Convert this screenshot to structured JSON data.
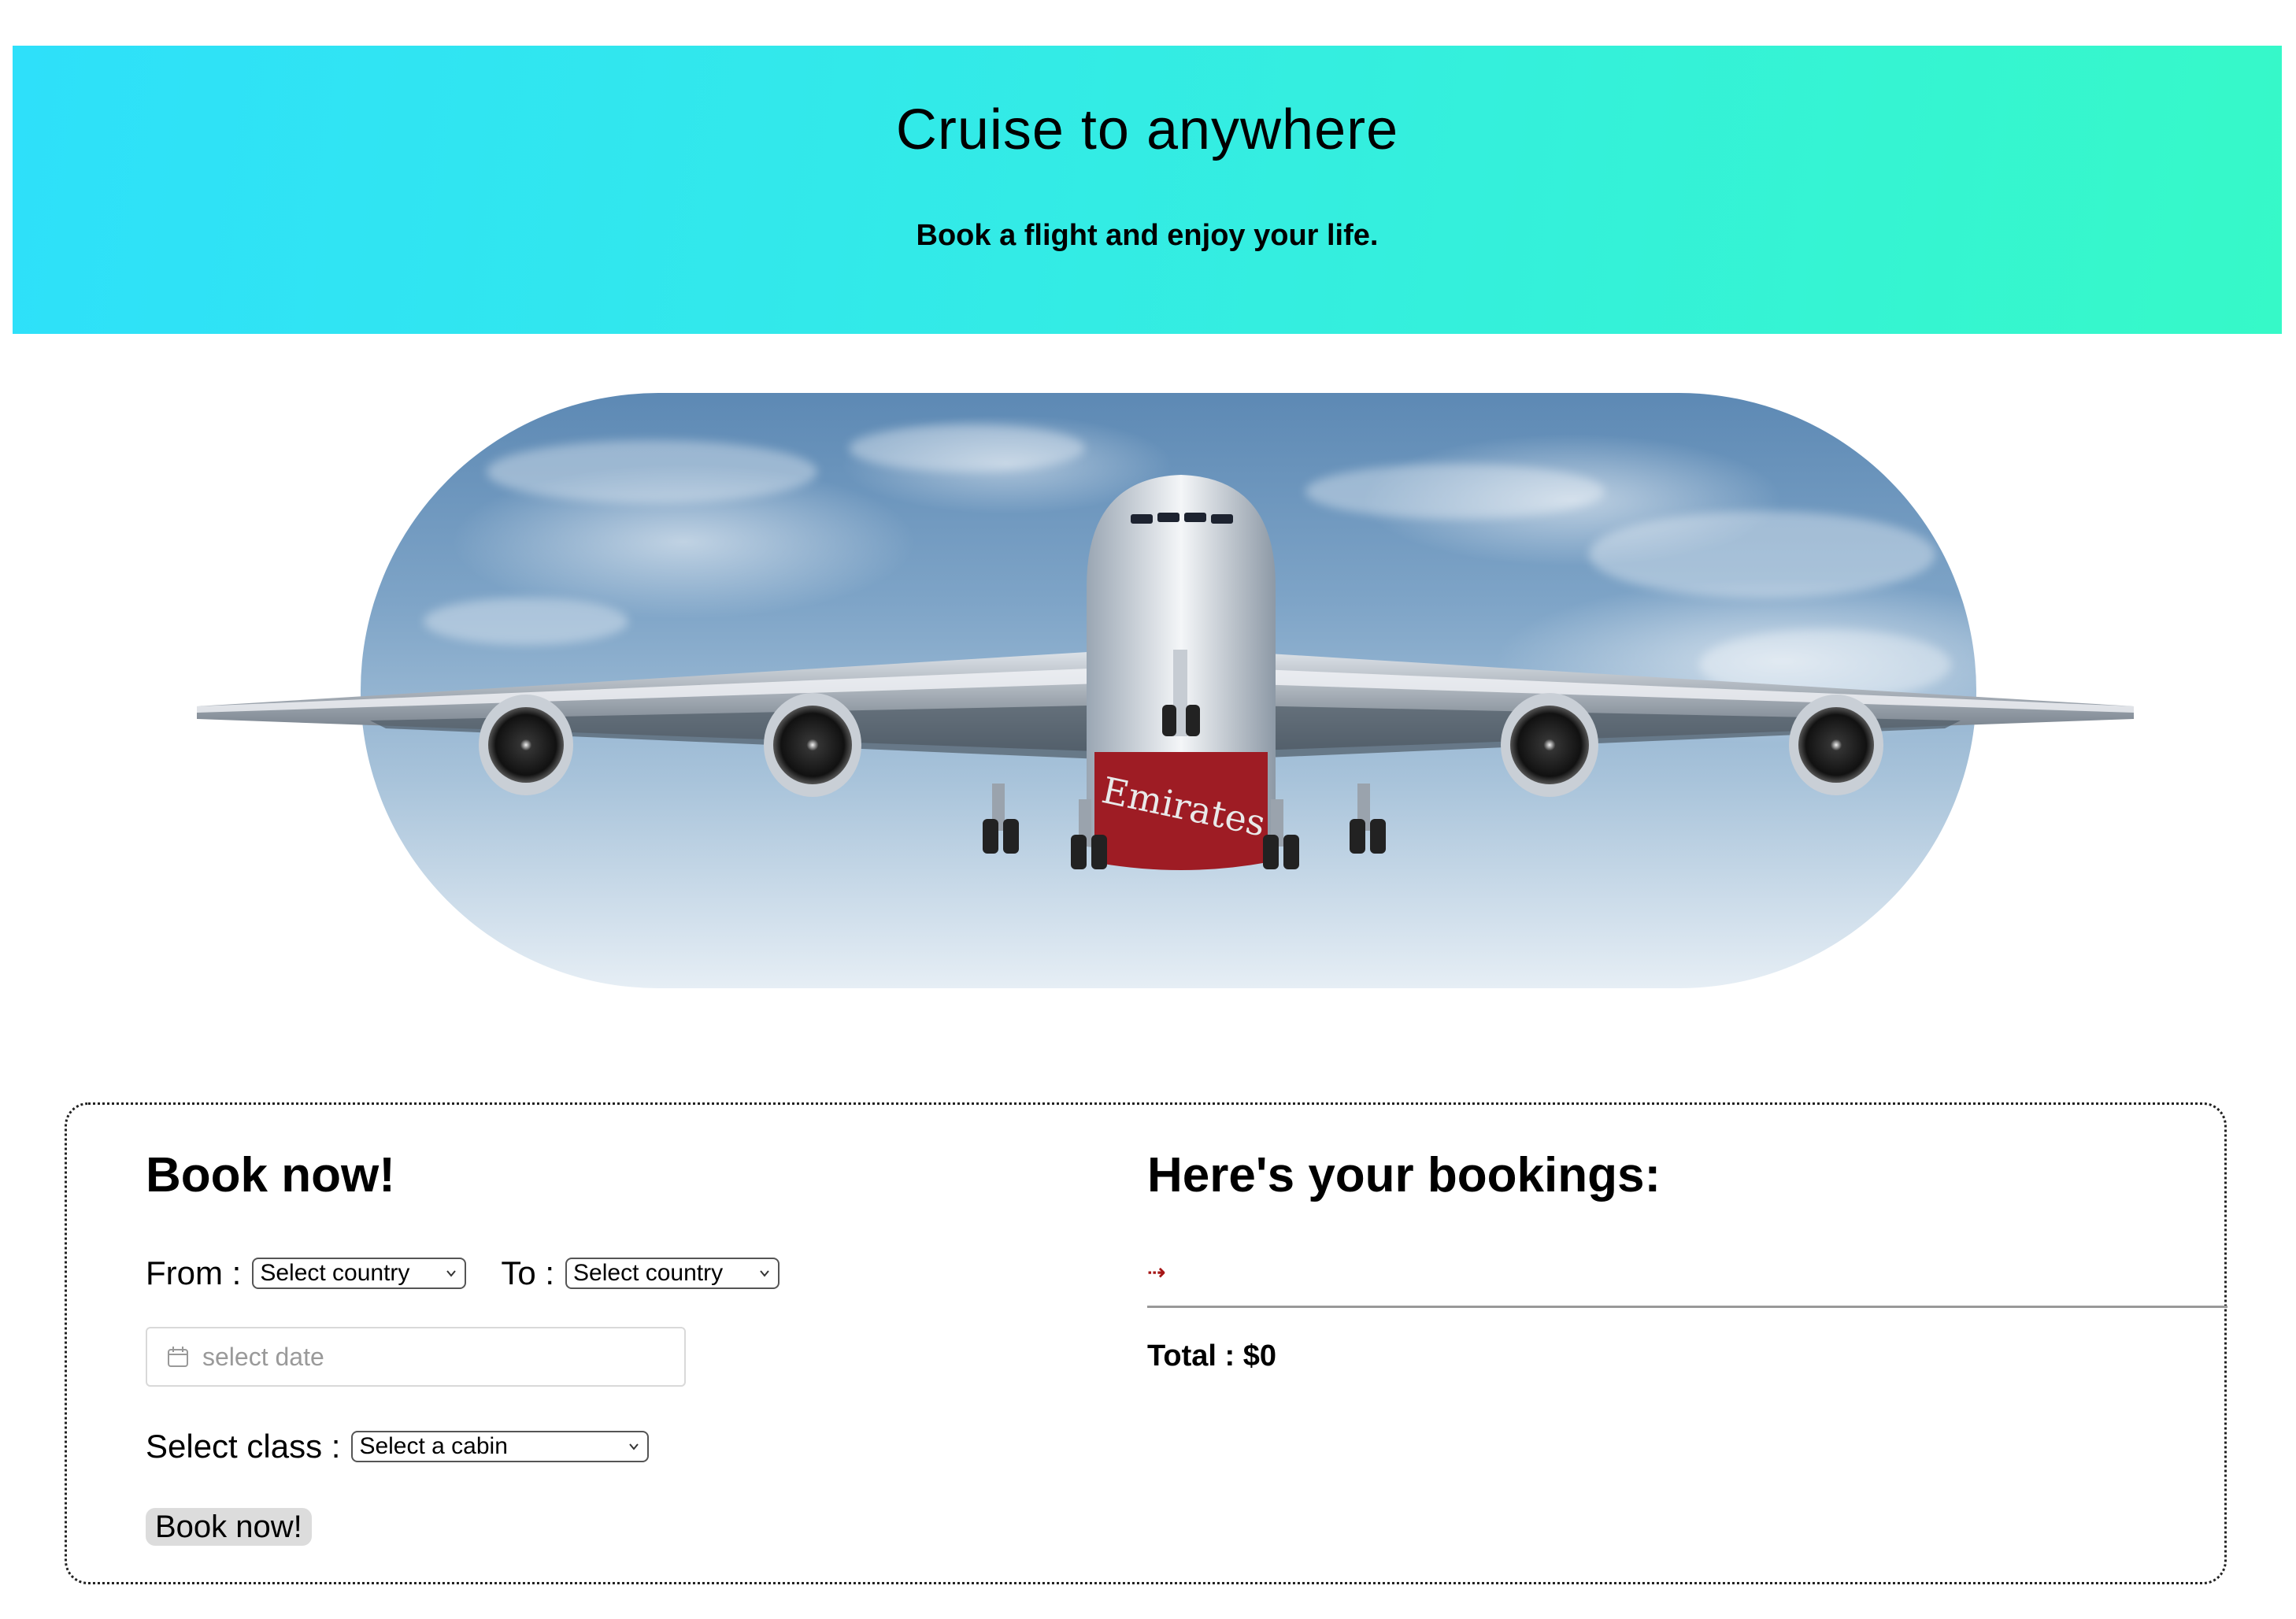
{
  "hero": {
    "title": "Cruise to anywhere",
    "subtitle": "Book a flight and enjoy your life."
  },
  "banner": {
    "image_alt": "airplane-photo",
    "airline_livery_text": "Emirates"
  },
  "booking_form": {
    "heading": "Book now!",
    "from_label": "From :",
    "from_value": "Select country",
    "to_label": "To :",
    "to_value": "Select country",
    "date_placeholder": "select date",
    "class_label": "Select class :",
    "class_value": "Select a cabin",
    "submit_label": "Book now!"
  },
  "bookings": {
    "heading": "Here's your bookings:",
    "route_arrow": "⇢",
    "total_label": "Total : $0"
  },
  "colors": {
    "gradient_start": "#2ee0fa",
    "gradient_end": "#36f9c8",
    "arrow": "#a61616"
  },
  "icons": {
    "calendar": "calendar-icon",
    "dropdown": "chevron-down-icon"
  }
}
